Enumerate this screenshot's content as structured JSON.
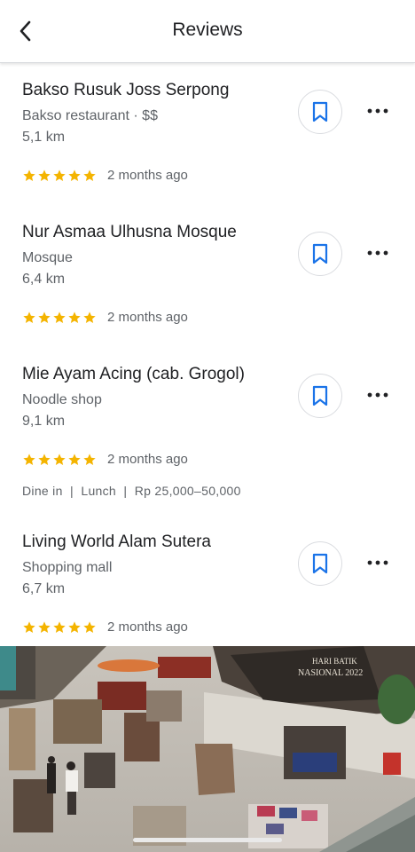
{
  "header": {
    "title": "Reviews"
  },
  "reviews": [
    {
      "name": "Bakso Rusuk Joss Serpong",
      "category": "Bakso restaurant",
      "price": "$$",
      "distance": "5,1 km",
      "stars": 5,
      "time_ago": "2 months ago",
      "extra": ""
    },
    {
      "name": "Nur Asmaa Ulhusna Mosque",
      "category": "Mosque",
      "price": "",
      "distance": "6,4 km",
      "stars": 5,
      "time_ago": "2 months ago",
      "extra": ""
    },
    {
      "name": "Mie Ayam Acing (cab. Grogol)",
      "category": "Noodle shop",
      "price": "",
      "distance": "9,1 km",
      "stars": 5,
      "time_ago": "2 months ago",
      "extra": "Dine in  |  Lunch  |  Rp 25,000–50,000"
    },
    {
      "name": "Living World Alam Sutera",
      "category": "Shopping mall",
      "price": "",
      "distance": "6,7 km",
      "stars": 5,
      "time_ago": "2 months ago",
      "extra": ""
    }
  ],
  "photo": {
    "banner_line1": "HARI BATIK",
    "banner_line2": "NASIONAL 2022"
  },
  "colors": {
    "star": "#f4b400",
    "bookmark": "#1a73e8"
  }
}
